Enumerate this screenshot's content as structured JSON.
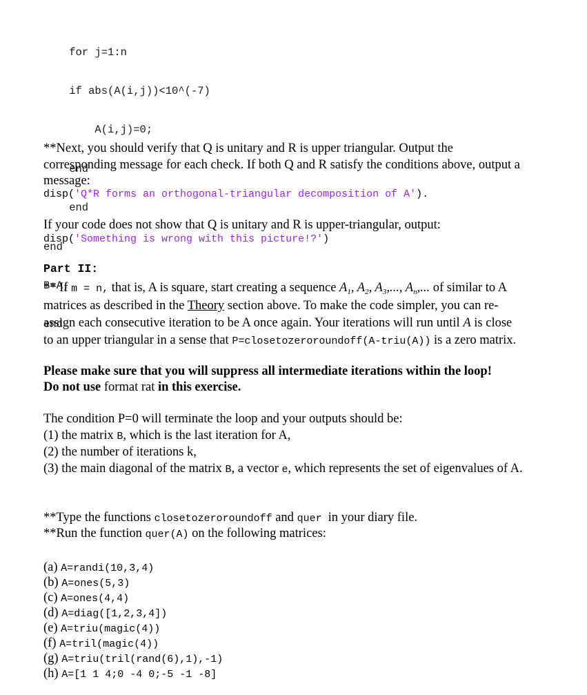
{
  "code_block": {
    "lines": [
      "    for j=1:n",
      "    if abs(A(i,j))<10^(-7)",
      "        A(i,j)=0;",
      "    end",
      "    end",
      "end",
      "B=A;",
      "end"
    ]
  },
  "verify": {
    "text_line1": "**Next, you should verify that Q is unitary and R is upper triangular. Output the",
    "text_line2": "corresponding message for each check. If both Q and R satisfy the conditions above, output a",
    "text_line3": "message:",
    "disp_prefix": "disp(",
    "disp_string": "'Q*R forms an orthogonal-triangular decomposition of A'",
    "disp_suffix": ")."
  },
  "failure": {
    "text": "If your code does not show that Q is unitary and R is upper-triangular, output:",
    "disp_prefix": "disp(",
    "disp_string": "'Something is wrong with this picture!?'",
    "disp_suffix": ")"
  },
  "part2": {
    "heading": "Part II:",
    "line1_a": "** If ",
    "line1_code": "m = n,",
    "line1_b": " that is, A is square, start creating a sequence ",
    "seq_A": "A",
    "seq_subs": [
      "1",
      "2",
      "3",
      "n"
    ],
    "line1_c": " of similar to A",
    "line2_a": "matrices as described in the ",
    "line2_link": "Theory",
    "line2_b": " section above. To make the code simpler, you can re-",
    "line3_a": "assign each consecutive iteration to be A once again. Your iterations will run until ",
    "line3_var": "A",
    "line3_b": " is close",
    "line4_a": "to an upper triangular in a sense that ",
    "line4_code": "P=closetozeroroundoff(A-triu(A))",
    "line4_b": " is a zero matrix."
  },
  "warning": {
    "line1": "Please make sure that you will suppress all intermediate iterations within the loop!",
    "line2_bold_a": "Do not use",
    "line2_plain": " format rat ",
    "line2_bold_b": "in this exercise."
  },
  "outputs": {
    "intro": "The condition P=0 will terminate the loop and your outputs should be:",
    "item1_a": "(1) the matrix ",
    "item1_code": "B",
    "item1_b": ", which is the last iteration for A,",
    "item2": "(2) the number of iterations k,",
    "item3_a": "(3) the main diagonal of the matrix ",
    "item3_code": "B",
    "item3_b": ", a vector ",
    "item3_code2": "e",
    "item3_c": ", which represents the set of eigenvalues of A."
  },
  "instructions": {
    "type_a": "**Type the functions ",
    "type_code1": "closetozeroroundoff",
    "type_b": " and ",
    "type_code2": "quer ",
    "type_c": " in your diary file.",
    "run_a": "**Run the function ",
    "run_code": "quer(A)",
    "run_b": "  on the following matrices:"
  },
  "matrices": [
    {
      "label": "(a) ",
      "code": "A=randi(10,3,4)"
    },
    {
      "label": "(b) ",
      "code": "A=ones(5,3)"
    },
    {
      "label": "(c) ",
      "code": "A=ones(4,4)"
    },
    {
      "label": "(d) ",
      "code": "A=diag([1,2,3,4])"
    },
    {
      "label": "(e) ",
      "code": "A=triu(magic(4))"
    },
    {
      "label": "(f) ",
      "code": "A=tril(magic(4))"
    },
    {
      "label": "(g) ",
      "code": "A=triu(tril(rand(6),1),-1)"
    },
    {
      "label": "(h) ",
      "code": "A=[1 1 4;0 -4 0;-5 -1 -8]"
    }
  ],
  "colors": {
    "string_literal": "#a020f0"
  }
}
